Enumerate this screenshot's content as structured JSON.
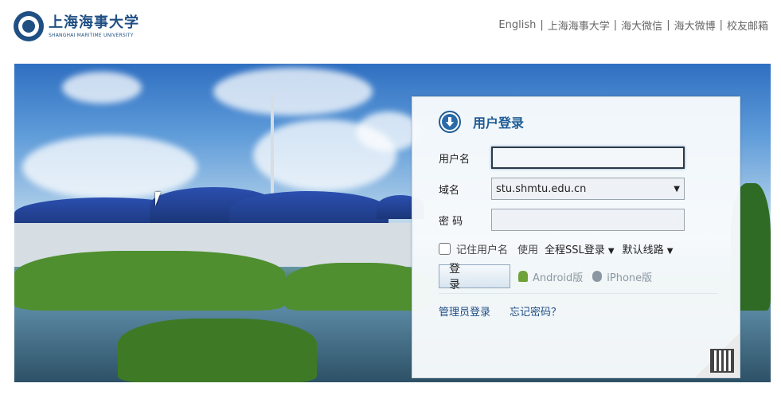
{
  "header": {
    "logo_cn": "上海海事大学",
    "logo_en": "SHANGHAI MARITIME UNIVERSITY",
    "links": [
      "English",
      "上海海事大学",
      "海大微信",
      "海大微博",
      "校友邮箱"
    ]
  },
  "login": {
    "title": "用户登录",
    "username_label": "用户名",
    "username_value": "",
    "domain_label": "域名",
    "domain_value": "stu.shmtu.edu.cn",
    "password_label": "密 码",
    "remember_label": "记住用户名",
    "use_label": "使用",
    "ssl_option": "全程SSL登录",
    "route_option": "默认线路",
    "login_button": "登　录",
    "android_link": "Android版",
    "iphone_link": "iPhone版",
    "admin_link": "管理员登录",
    "forgot_link": "忘记密码？"
  },
  "colors": {
    "brand": "#1f4f83",
    "title": "#1f5d96",
    "link_gray": "#666666"
  }
}
